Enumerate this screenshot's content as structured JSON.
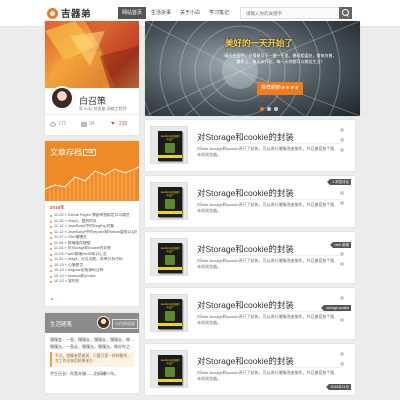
{
  "header": {
    "logo_text": "吉器弟",
    "nav": [
      "网站首页",
      "生活杂事",
      "关于小白",
      "学习笔记"
    ],
    "search_placeholder": "请输入你的关键字"
  },
  "profile": {
    "name": "白召策",
    "desc": "男 90后 处女座 网络工程师",
    "views": "172",
    "comments": "34",
    "likes": "210"
  },
  "archive": {
    "title": "文章存档",
    "count": "15篇",
    "year": "2016年",
    "items": [
      "11-29 » Github Pages 博客单独绑定公司域名",
      "11-15 » JekyII，遇到的坑",
      "11-12 » JavaScript中的RegExp对象",
      "11-12 » JavaScript中的repaint和Reflow重排以及样式优化",
      "11-07 » JSer御膳关",
      "11-06 » 前端缓存梗楼",
      "11-04 » 对Storage和cookie的封装",
      "11-03 » web前端html5知识汇总",
      "11-02 » Jekyll，分页功能，简单分析代码",
      "10-15 » 心情感言",
      "10-15 » angular初始源码注释",
      "10-14 » session和cookie",
      "10-12 » 我的秋"
    ]
  },
  "life": {
    "title": "生活随笔",
    "nickname": "小白的语录",
    "line1": "慢慢变，一直，慢慢去，慢慢去，慢慢去，做…",
    "line2": "慢慢去，一直走，慢慢去，慢慢去，做好你之…",
    "quote": "不过，就算老是难说，只要只是一样的繁杂，交工作出来用结果来主…",
    "line3": "余生还长！你我未婚——别搞糟少年。"
  },
  "hero": {
    "title": "美好的一天开始了",
    "text": "晴天白云午，日落星月下一望一千里，暴雨相逢处，雷电何曾，繁华上，春天永开花，每一天你都可以微笑生活！",
    "button": "推荐刷新★★★★"
  },
  "posts": [
    {
      "title": "对Storage和cookie的封装",
      "desc": "对web storage和cookie进行了封装，可以进行增删改查操作，并且兼容各个版本的浏览器。",
      "book": "JavaScript高级程序设计",
      "tag": ""
    },
    {
      "title": "对Storage和cookie的封装",
      "desc": "对web storage和cookie进行了封装，可以进行增删改查操作，并且兼容各个版本的浏览器。",
      "book": "JavaScript高级程序设计",
      "tag": "1 浏览评论"
    },
    {
      "title": "对Storage和cookie的封装",
      "desc": "对web storage和cookie进行了封装，可以进行增删改查操作，并且兼容各个版本的浏览器。",
      "book": "JavaScript高级程序设计",
      "tag": "web 前端"
    },
    {
      "title": "对Storage和cookie的封装",
      "desc": "对web storage和cookie进行了封装，可以进行增删改查操作，并且兼容各个版本的浏览器。",
      "book": "JavaScript高级程序设计",
      "tag": "storage,cookie"
    },
    {
      "title": "对Storage和cookie的封装",
      "desc": "对web storage和cookie进行了封装，可以进行增删改查操作，并且兼容各个版本的浏览器。",
      "book": "JavaScript高级程序设计",
      "tag": "2016年11月"
    }
  ],
  "colors": {
    "accent": "#f07b1d",
    "archive": "#f08a24",
    "dark": "#555555"
  }
}
